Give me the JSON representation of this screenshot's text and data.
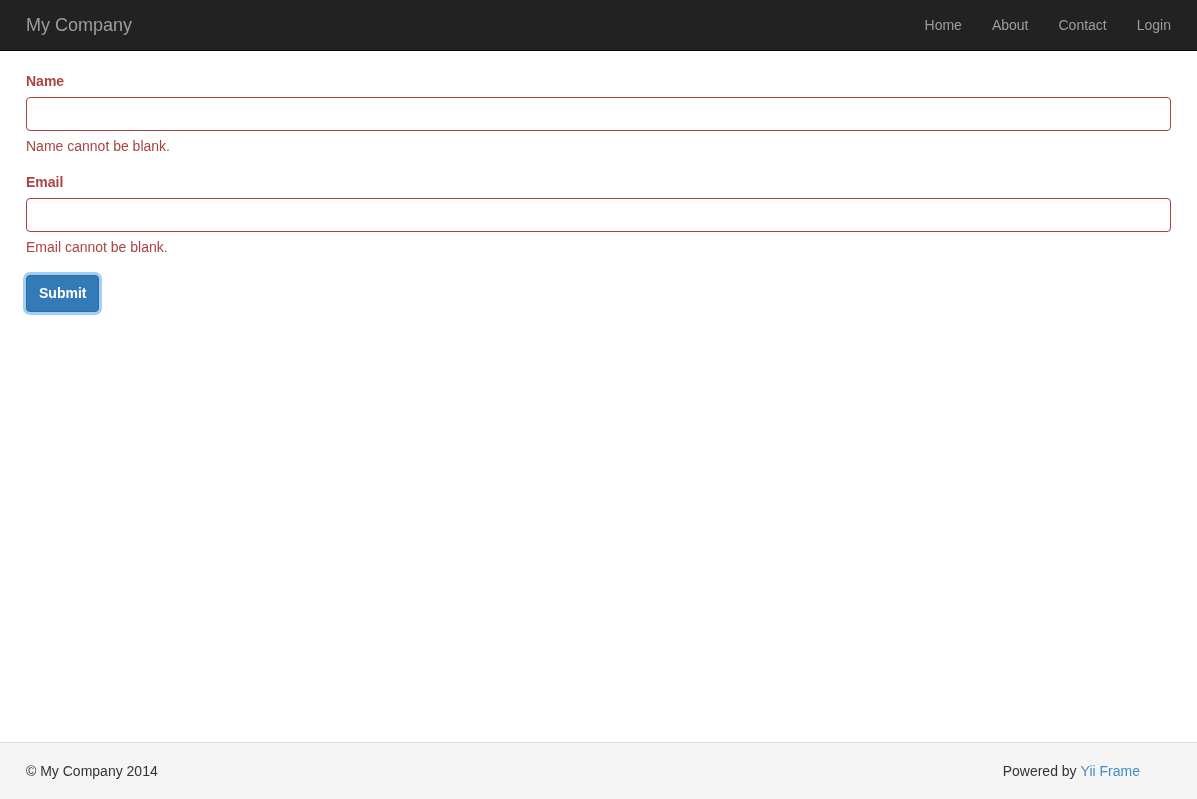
{
  "navbar": {
    "brand": "My Company",
    "items": [
      {
        "label": "Home",
        "selected": false
      },
      {
        "label": "About",
        "selected": false
      },
      {
        "label": "Contact",
        "selected": false
      },
      {
        "label": "Login",
        "selected": false
      }
    ]
  },
  "form": {
    "fields": [
      {
        "label": "Name",
        "error": "Name cannot be blank.",
        "invalid": true
      },
      {
        "label": "Email",
        "error": "Email cannot be blank.",
        "invalid": true
      }
    ],
    "submit": "Submit"
  },
  "footer": {
    "copyright": "© My Company 2014",
    "powered_by": "Powered by",
    "link": "Yii Frame"
  }
}
